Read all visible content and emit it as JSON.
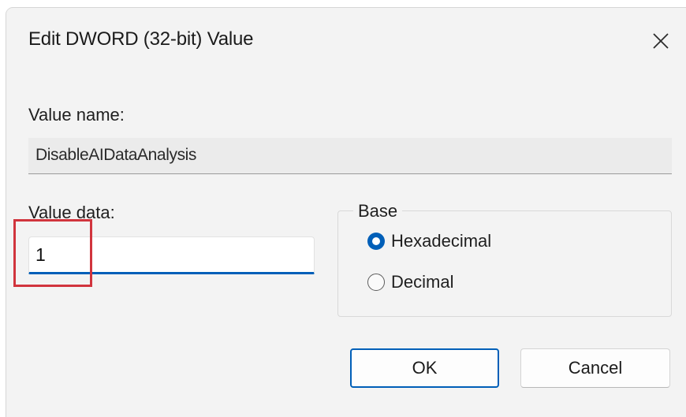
{
  "dialog": {
    "title": "Edit DWORD (32-bit) Value",
    "close_icon": "close-icon"
  },
  "value_name": {
    "label": "Value name:",
    "value": "DisableAIDataAnalysis"
  },
  "value_data": {
    "label": "Value data:",
    "value": "1",
    "highlight_color": "#d1343d"
  },
  "base": {
    "legend": "Base",
    "options": [
      {
        "label": "Hexadecimal",
        "selected": true
      },
      {
        "label": "Decimal",
        "selected": false
      }
    ]
  },
  "buttons": {
    "ok": "OK",
    "cancel": "Cancel"
  },
  "colors": {
    "accent": "#005fb8",
    "dialog_background": "#f3f3f3"
  }
}
